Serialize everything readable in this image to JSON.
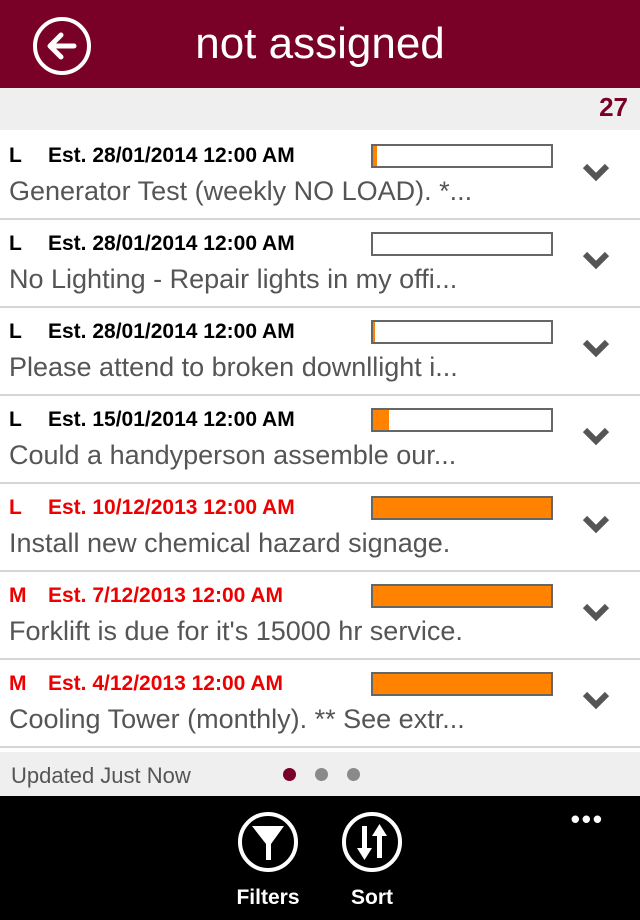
{
  "header": {
    "title": "not assigned",
    "back_icon": "back-arrow-icon"
  },
  "count": "27",
  "colors": {
    "brand": "#790027",
    "progress": "#ff8200",
    "overdue": "#e00000"
  },
  "items": [
    {
      "priority": "L",
      "est": "Est. 28/01/2014 12:00 AM",
      "desc": "Generator Test (weekly NO LOAD).  *...",
      "progress": 2,
      "overdue": false
    },
    {
      "priority": "L",
      "est": "Est. 28/01/2014 12:00 AM",
      "desc": "No Lighting - Repair lights in my offi...",
      "progress": 0,
      "overdue": false
    },
    {
      "priority": "L",
      "est": "Est. 28/01/2014 12:00 AM",
      "desc": "Please attend to broken downllight i...",
      "progress": 1,
      "overdue": false
    },
    {
      "priority": "L",
      "est": "Est. 15/01/2014 12:00 AM",
      "desc": "Could a handyperson assemble our...",
      "progress": 9,
      "overdue": false
    },
    {
      "priority": "L",
      "est": "Est. 10/12/2013 12:00 AM",
      "desc": "Install new chemical hazard signage.",
      "progress": 100,
      "overdue": true
    },
    {
      "priority": "M",
      "est": "Est. 7/12/2013 12:00 AM",
      "desc": "Forklift is due for it's 15000 hr service.",
      "progress": 100,
      "overdue": true
    },
    {
      "priority": "M",
      "est": "Est. 4/12/2013 12:00 AM",
      "desc": "Cooling Tower (monthly).  ** See extr...",
      "progress": 100,
      "overdue": true
    }
  ],
  "status": {
    "updated": "Updated Just Now",
    "pages": 3,
    "current_page": 1
  },
  "appbar": {
    "filters": "Filters",
    "sort": "Sort",
    "more": "•••"
  }
}
